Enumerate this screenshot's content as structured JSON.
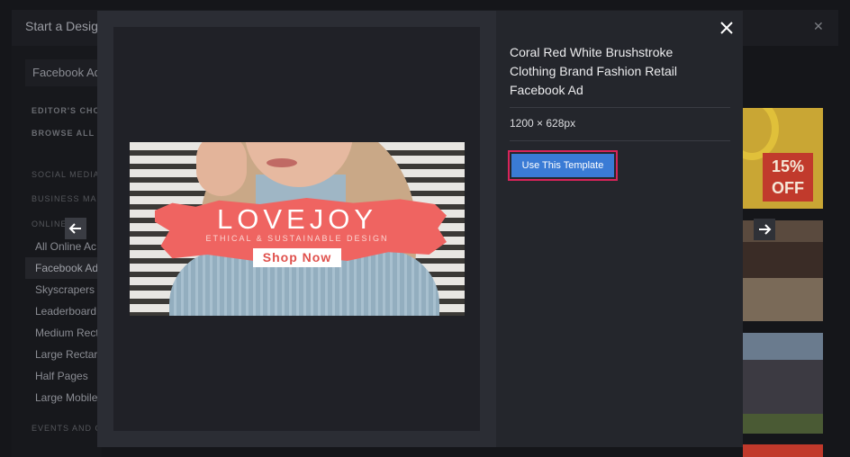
{
  "background": {
    "title": "Start a Desig",
    "search_value": "Facebook Ad",
    "sections": {
      "editors_choice": "EDITOR'S CHO",
      "browse_all": "BROWSE ALL T",
      "social_media": "SOCIAL MEDIA",
      "business": "BUSINESS MA",
      "online": "ONLINE",
      "events": "EVENTS AND C"
    },
    "items": [
      "All Online Ac",
      "Facebook Ad",
      "Skyscrapers",
      "Leaderboard",
      "Medium Rect",
      "Large Rectar",
      "Half Pages",
      "Large Mobile"
    ],
    "thumb_sale_text": "15% OFF"
  },
  "modal": {
    "template_title": "Coral Red White Brushstroke Clothing Brand Fashion Retail Facebook Ad",
    "template_size": "1200 × 628px",
    "use_button_label": "Use This Template",
    "close_icon": "close-icon",
    "ad": {
      "brand": "LOVEJOY",
      "tagline": "ETHICAL & SUSTAINABLE DESIGN",
      "cta": "Shop Now"
    }
  },
  "colors": {
    "accent": "#3a7bd5",
    "highlight_border": "#d8245a",
    "ad_coral": "#ef6461"
  }
}
